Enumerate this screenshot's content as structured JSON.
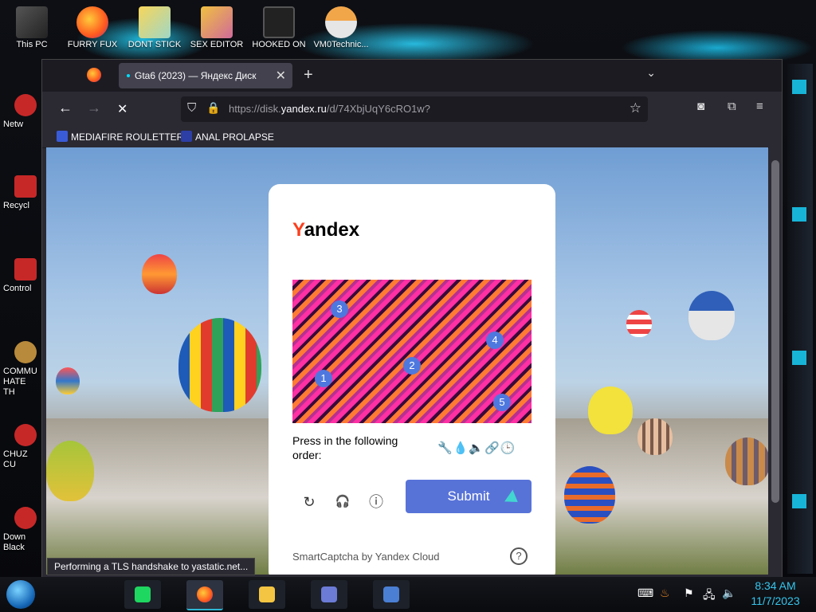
{
  "desktop": {
    "top_icons": [
      {
        "label": "This PC"
      },
      {
        "label": "FURRY FUX"
      },
      {
        "label": "DONT STICK"
      },
      {
        "label": "SEX EDITOR"
      },
      {
        "label": "HOOKED ON"
      },
      {
        "label": "VM0Technic..."
      }
    ],
    "side_icons": [
      {
        "label": "Netw"
      },
      {
        "label": "Recycl"
      },
      {
        "label": "Control"
      },
      {
        "label": "COMMU HATE TH"
      },
      {
        "label": "CHUZ CU"
      },
      {
        "label": "Down Black"
      }
    ]
  },
  "browser": {
    "tab": {
      "title": "Gta6 (2023) — Яндекс Диск",
      "close": "✕"
    },
    "new_tab": "+",
    "list_tabs": "⌄",
    "nav": {
      "back": "←",
      "forward": "→",
      "stop": "✕"
    },
    "url": {
      "prefix": "https://disk.",
      "host": "yandex.ru",
      "path": "/d/74XbjUqY6cRO1w?"
    },
    "bookmarks": [
      {
        "label": "MEDIAFIRE ROULETTER",
        "color": "#3a5bd8"
      },
      {
        "label": "ANAL PROLAPSE",
        "color": "#2d3ea5"
      }
    ],
    "status_text": "Performing a TLS handshake to yastatic.net..."
  },
  "captcha": {
    "brand_first": "Y",
    "brand_rest": "andex",
    "markers": [
      "3",
      "4",
      "2",
      "1",
      "5"
    ],
    "instruction": "Press in the following order:",
    "order_icons": "🔧💧🔈🔗🕒",
    "controls": {
      "refresh": "↻",
      "audio": "🎧",
      "info": "ⓘ"
    },
    "submit_label": "Submit",
    "footer": "SmartCaptcha by Yandex Cloud",
    "help": "?"
  },
  "taskbar": {
    "time": "8:34 AM",
    "date": "11/7/2023"
  }
}
